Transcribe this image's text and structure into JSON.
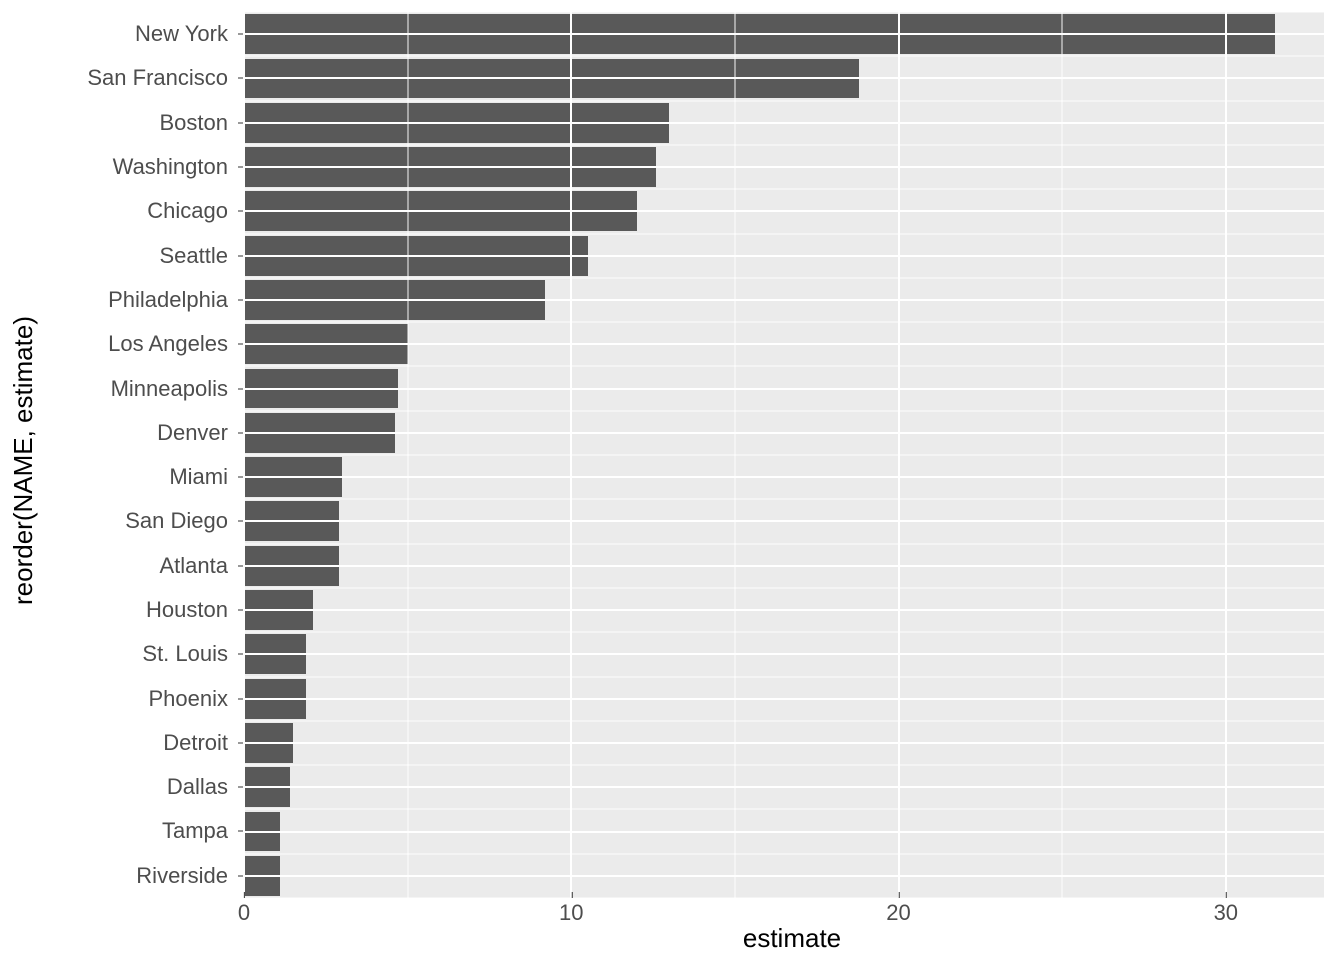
{
  "chart_data": {
    "type": "bar",
    "orientation": "horizontal",
    "xlabel": "estimate",
    "ylabel": "reorder(NAME, estimate)",
    "xlim": [
      0,
      33
    ],
    "x_breaks": [
      0,
      10,
      20,
      30
    ],
    "x_minor_breaks": [
      5,
      15,
      25
    ],
    "bar_fill": "#595959",
    "panel_bg": "#ebebeb",
    "categories": [
      "New York",
      "San Francisco",
      "Boston",
      "Washington",
      "Chicago",
      "Seattle",
      "Philadelphia",
      "Los Angeles",
      "Minneapolis",
      "Denver",
      "Miami",
      "San Diego",
      "Atlanta",
      "Houston",
      "St. Louis",
      "Phoenix",
      "Detroit",
      "Dallas",
      "Tampa",
      "Riverside"
    ],
    "values": [
      31.5,
      18.8,
      13.0,
      12.6,
      12.0,
      10.5,
      9.2,
      5.0,
      4.7,
      4.6,
      3.0,
      2.9,
      2.9,
      2.1,
      1.9,
      1.9,
      1.5,
      1.4,
      1.1,
      1.1
    ]
  }
}
